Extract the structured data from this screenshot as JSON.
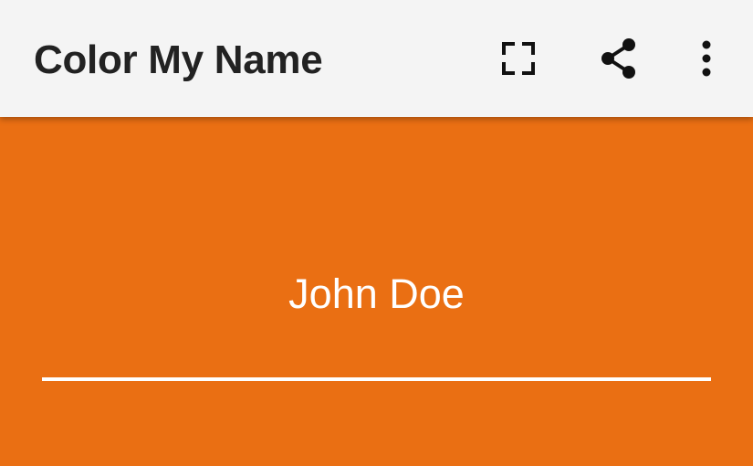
{
  "app_bar": {
    "title": "Color My Name",
    "actions": [
      {
        "name": "fullscreen",
        "icon": "fullscreen-icon"
      },
      {
        "name": "share",
        "icon": "share-icon"
      },
      {
        "name": "more-options",
        "icon": "more-vert-icon"
      }
    ]
  },
  "main": {
    "name_value": "John Doe"
  },
  "colors": {
    "app_bar_background": "#f4f4f4",
    "content_background": "#ea6f13",
    "text_primary": "#222222",
    "name_text": "#ffffff",
    "underline": "#ffffff"
  }
}
